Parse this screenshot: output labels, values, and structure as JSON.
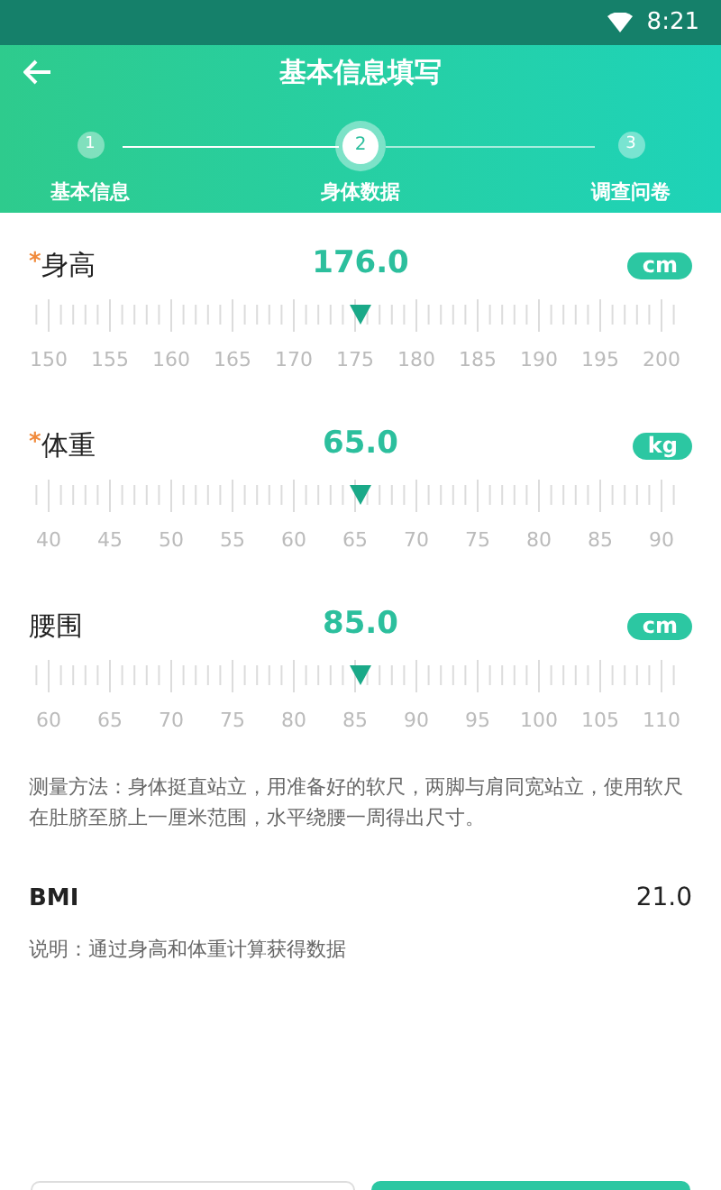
{
  "status_bar": {
    "time": "8:21"
  },
  "header": {
    "title": "基本信息填写"
  },
  "steps": [
    {
      "number": "1",
      "label": "基本信息",
      "selected": false
    },
    {
      "number": "2",
      "label": "身体数据",
      "selected": true
    },
    {
      "number": "3",
      "label": "调查问卷",
      "selected": false
    }
  ],
  "required_mark": "*",
  "measurements": [
    {
      "label": "身高",
      "required": true,
      "value": "176.0",
      "unit": "cm",
      "scale": [
        "150",
        "155",
        "160",
        "165",
        "170",
        "175",
        "180",
        "185",
        "190",
        "195",
        "200"
      ]
    },
    {
      "label": "体重",
      "required": true,
      "value": "65.0",
      "unit": "kg",
      "scale": [
        "40",
        "45",
        "50",
        "55",
        "60",
        "65",
        "70",
        "75",
        "80",
        "85",
        "90"
      ]
    },
    {
      "label": "腰围",
      "required": false,
      "value": "85.0",
      "unit": "cm",
      "scale": [
        "60",
        "65",
        "70",
        "75",
        "80",
        "85",
        "90",
        "95",
        "100",
        "105",
        "110"
      ]
    }
  ],
  "measure_note": "测量方法：身体挺直站立，用准备好的软尺，两脚与肩同宽站立，使用软尺在肚脐至脐上一厘米范围，水平绕腰一周得出尺寸。",
  "bmi": {
    "label": "BMI",
    "value": "21.0",
    "note": "说明：通过身高和体重计算获得数据"
  }
}
